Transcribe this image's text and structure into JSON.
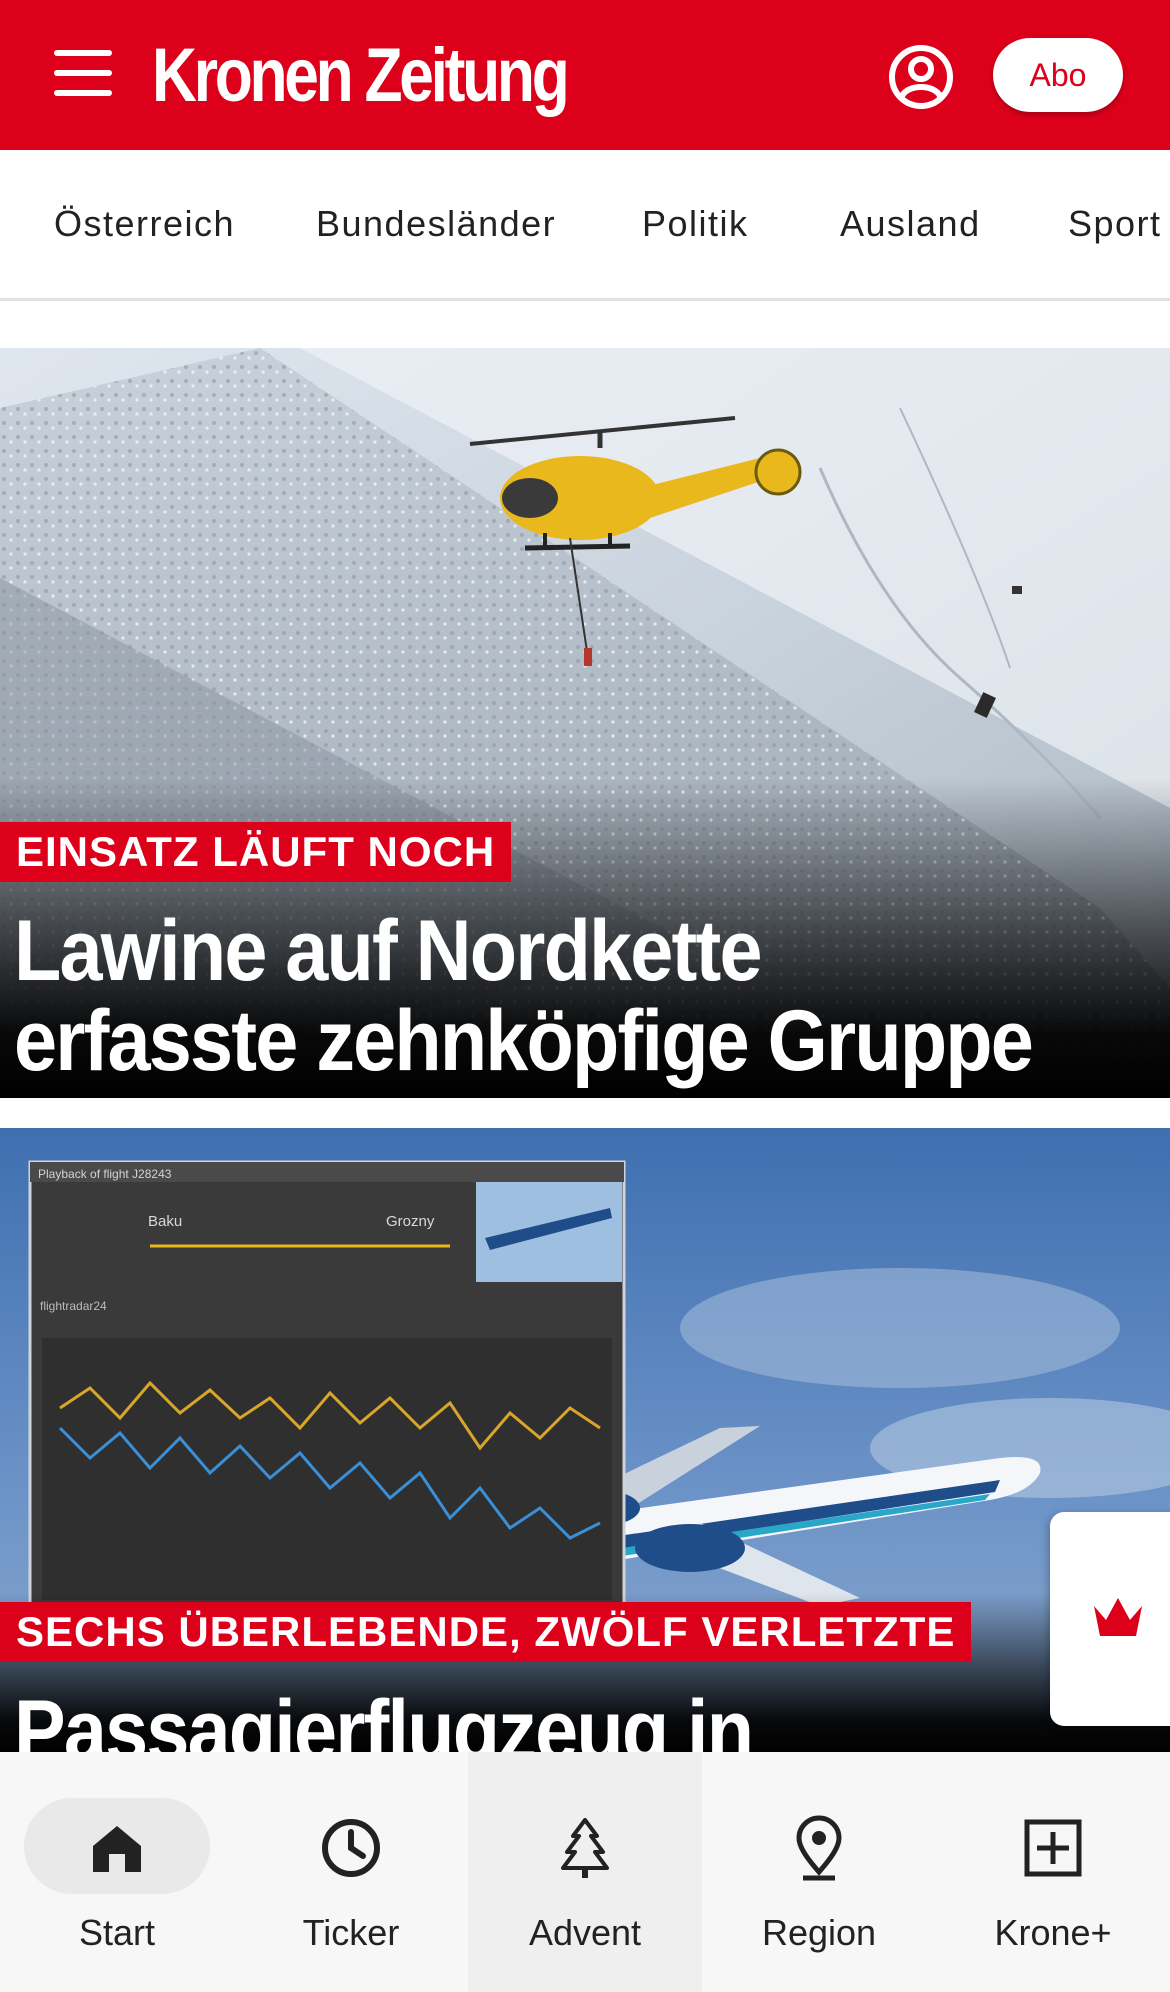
{
  "header": {
    "logo_text": "Kronen Zeitung",
    "abo_label": "Abo",
    "brand_color": "#dd001a"
  },
  "nav": {
    "items": [
      {
        "label": "Österreich"
      },
      {
        "label": "Bundesländer"
      },
      {
        "label": "Politik"
      },
      {
        "label": "Ausland"
      },
      {
        "label": "Sport"
      }
    ]
  },
  "articles": [
    {
      "kicker": "EINSATZ LÄUFT NOCH",
      "headline_line1": "Lawine auf Nordkette",
      "headline_line2": "erfasste zehnköpfige Gruppe"
    },
    {
      "kicker": "SECHS ÜBERLEBENDE, ZWÖLF VERLETZTE",
      "headline_line1": "Passagierflugzeug in"
    }
  ],
  "inset": {
    "title": "Playback of flight J28243",
    "from": "Baku",
    "to": "Grozny",
    "brand": "flightradar24"
  },
  "bottom_nav": {
    "items": [
      {
        "label": "Start",
        "icon": "home-icon"
      },
      {
        "label": "Ticker",
        "icon": "clock-icon"
      },
      {
        "label": "Advent",
        "icon": "tree-icon"
      },
      {
        "label": "Region",
        "icon": "location-pin-icon"
      },
      {
        "label": "Krone+",
        "icon": "plus-square-icon"
      }
    ]
  }
}
